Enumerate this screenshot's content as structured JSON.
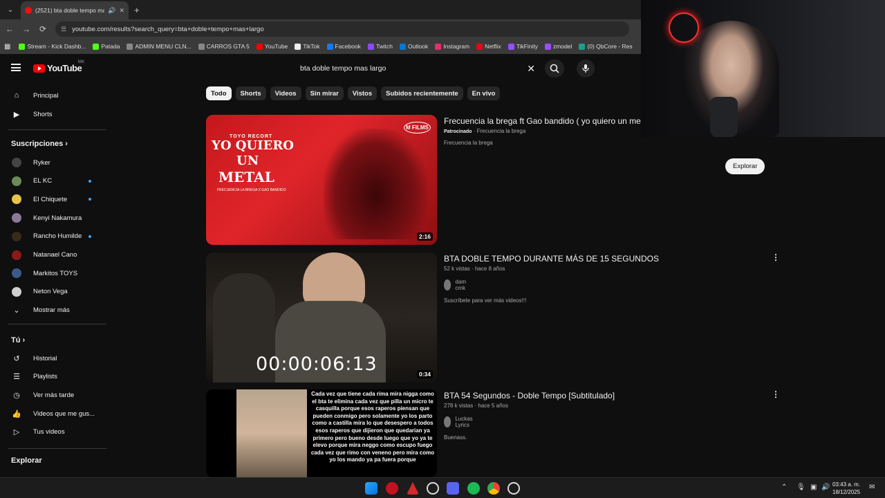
{
  "browser": {
    "tab_title": "(2521) bta doble tempo ma",
    "url": "youtube.com/results?search_query=bta+doble+tempo+mas+largo",
    "bookmarks": [
      "Stream - Kick Dashb...",
      "Patada",
      "ADMIN MENU CLN...",
      "CARROS GTA 5",
      "YouTube",
      "TikTok",
      "Facebook",
      "Twitch",
      "Outlook",
      "Instagram",
      "Netflix",
      "TikFinity",
      "zmodel",
      "(0) QbCore - Res"
    ]
  },
  "header": {
    "logo": "YouTube",
    "country": "MX",
    "search_query": "bta doble tempo mas largo"
  },
  "chips": [
    "Todo",
    "Shorts",
    "Videos",
    "Sin mirar",
    "Vistos",
    "Subidos recientemente",
    "En vivo"
  ],
  "sidebar": {
    "main": [
      {
        "label": "Principal",
        "icon": "home-icon"
      },
      {
        "label": "Shorts",
        "icon": "shorts-icon"
      }
    ],
    "subs_title": "Suscripciones",
    "subs": [
      {
        "label": "Ryker",
        "dot": false
      },
      {
        "label": "EL KC",
        "dot": true
      },
      {
        "label": "El Chiquete",
        "dot": true
      },
      {
        "label": "Kenyi Nakamura",
        "dot": false
      },
      {
        "label": "Rancho Humilde",
        "dot": true
      },
      {
        "label": "Natanael Cano",
        "dot": false
      },
      {
        "label": "Markitos TOYS",
        "dot": false
      },
      {
        "label": "Neton Vega",
        "dot": false
      }
    ],
    "more": "Mostrar más",
    "you_title": "Tú",
    "you": [
      {
        "label": "Historial",
        "icon": "history-icon"
      },
      {
        "label": "Playlists",
        "icon": "playlist-icon"
      },
      {
        "label": "Ver más tarde",
        "icon": "clock-icon"
      },
      {
        "label": "Videos que me gus...",
        "icon": "like-icon"
      },
      {
        "label": "Tus videos",
        "icon": "video-icon"
      }
    ],
    "explore_title": "Explorar"
  },
  "results": [
    {
      "title": "Frecuencia la brega ft Gao bandido ( yo quiero un metal",
      "sponsored": "Patrocinado",
      "channel": "Frecuencia la brega",
      "desc": "Frecuencia la brega",
      "duration": "2:16",
      "thumb_text": [
        "YO QUIERO",
        "UN",
        "METAL"
      ],
      "thumb_small": "TOYO RECORT",
      "thumb_sub": "FRECUENCIA LA BREGA X GAO BANDIDO",
      "thumb_logo": "M FILMS"
    },
    {
      "title": "BTA DOBLE TEMPO DURANTE MÁS DE 15 SEGUNDOS",
      "views": "52 k vistas",
      "age": "hace 8 años",
      "channel": "dam cmk",
      "desc": "Suscríbete para ver más videos!!!",
      "duration": "0:34",
      "timer": "00:00:06:13"
    },
    {
      "title": "BTA 54 Segundos - Doble Tempo [Subtitulado]",
      "views": "278 k vistas",
      "age": "hace 5 años",
      "channel": "Luckas Lyrics",
      "desc": "Buenass.",
      "lyrics": "Cada vez que tiene cada rima mira nigga como el bta te elimina cada vez que pilla un micro te casquilla porque esos raperos piensan que pueden conmigo pero solamente yo los parto como a castilla mira lo que desespero a todos esos raperos que dijieron que quedarian ya primero pero bueno desde luego que yo ya te elevo porque mira neggo como escupo fuego cada vez que rimo con veneno pero mira como yo los mando ya pa fuera porque"
    }
  ],
  "explore_button": "Explorar",
  "taskbar": {
    "time": "03:43 a. m.",
    "date": "18/12/2025"
  },
  "colors": {
    "bg": "#0f0f0f",
    "accent": "#ff0000",
    "link": "#3ea6ff"
  }
}
